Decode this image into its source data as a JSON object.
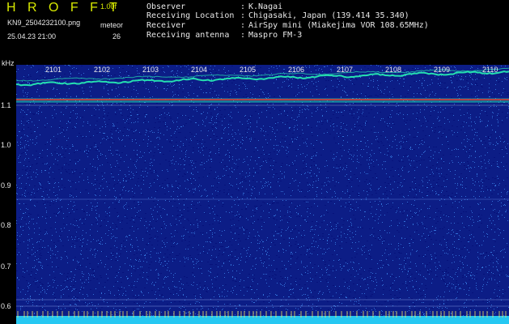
{
  "header": {
    "app_name": "H R O F F T",
    "version": "1.00f",
    "filename": "KN9_2504232100.png",
    "timestamp": "25.04.23 21:00",
    "meteor_label": "meteor",
    "meteor_count": "26"
  },
  "station": {
    "observer_key": "Observer",
    "observer_val": "K.Nagai",
    "location_key": "Receiving Location",
    "location_val": "Chigasaki, Japan (139.414 35.340)",
    "receiver_key": "Receiver",
    "receiver_val": "AirSpy mini (Miakejima VOR 108.65MHz)",
    "antenna_key": "Receiving antenna",
    "antenna_val": "Maspro FM-3",
    "separator": ":"
  },
  "axis": {
    "unit": "kHz",
    "y_ticks": [
      "1.1",
      "1.0",
      "0.9",
      "0.8",
      "0.7",
      "0.6"
    ],
    "x_ticks": [
      "2101",
      "2102",
      "2103",
      "2104",
      "2105",
      "2106",
      "2107",
      "2108",
      "2109",
      "2110"
    ]
  },
  "colors": {
    "background": "#0c1d86",
    "noise_light": "#3f8cf2",
    "noise_dark": "#06127a",
    "carrier": "#e63c2d",
    "trace": "#25e0b0",
    "bottom_band": "#26c8f2"
  }
}
